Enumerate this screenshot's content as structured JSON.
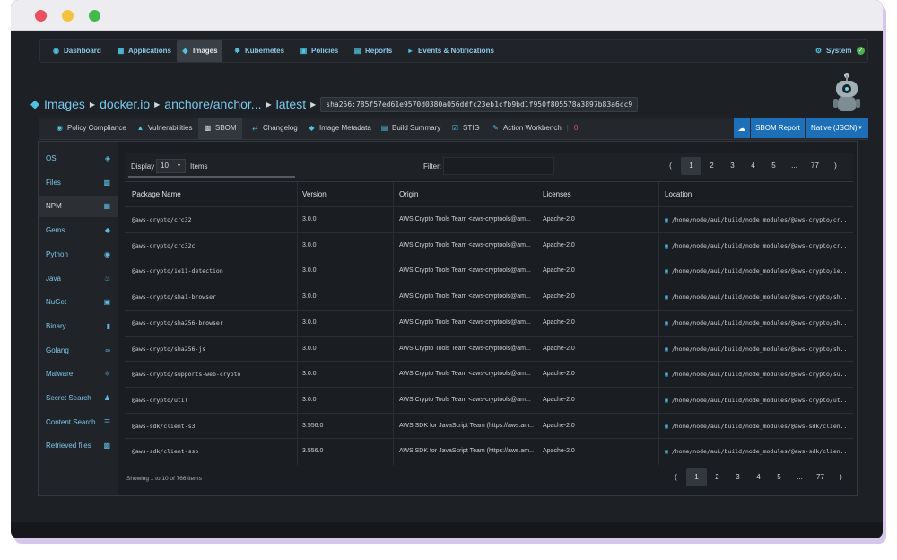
{
  "nav": {
    "items": [
      {
        "label": "Dashboard",
        "icon": "dashboard-icon"
      },
      {
        "label": "Applications",
        "icon": "grid-icon"
      },
      {
        "label": "Images",
        "icon": "tag-icon"
      },
      {
        "label": "Kubernetes",
        "icon": "kubernetes-icon"
      },
      {
        "label": "Policies",
        "icon": "briefcase-icon"
      },
      {
        "label": "Reports",
        "icon": "table-icon"
      },
      {
        "label": "Events & Notifications",
        "icon": "megaphone-icon"
      }
    ],
    "system_label": "System"
  },
  "breadcrumb": {
    "images": "Images",
    "registry": "docker.io",
    "repo": "anchore/anchor...",
    "tag": "latest",
    "digest": "sha256:785f57ed61e9570d0380a056ddfc23eb1cfb9bd1f950f805578a3897b83a6cc9"
  },
  "tabs": [
    {
      "label": "Policy Compliance",
      "icon": "policy-icon"
    },
    {
      "label": "Vulnerabilities",
      "icon": "flame-icon"
    },
    {
      "label": "SBOM",
      "icon": "file-icon"
    },
    {
      "label": "Changelog",
      "icon": "arrows-icon"
    },
    {
      "label": "Image Metadata",
      "icon": "tag-icon"
    },
    {
      "label": "Build Summary",
      "icon": "build-icon"
    },
    {
      "label": "STIG",
      "icon": "check-icon"
    },
    {
      "label": "Action Workbench",
      "icon": "edit-icon"
    }
  ],
  "action_count": "0",
  "sbom_report_label": "SBOM Report",
  "format_label": "Native (JSON)",
  "sidebar": [
    {
      "label": "OS",
      "icon": "drop-icon"
    },
    {
      "label": "Files",
      "icon": "file-icon"
    },
    {
      "label": "NPM",
      "icon": "npm-icon"
    },
    {
      "label": "Gems",
      "icon": "gem-icon"
    },
    {
      "label": "Python",
      "icon": "python-icon"
    },
    {
      "label": "Java",
      "icon": "java-icon"
    },
    {
      "label": "NuGet",
      "icon": "nuget-icon"
    },
    {
      "label": "Binary",
      "icon": "binary-icon"
    },
    {
      "label": "Golang",
      "icon": "golang-icon"
    },
    {
      "label": "Malware",
      "icon": "bug-icon"
    },
    {
      "label": "Secret Search",
      "icon": "user-secret-icon"
    },
    {
      "label": "Content Search",
      "icon": "list-icon"
    },
    {
      "label": "Retrieved files",
      "icon": "file-icon"
    }
  ],
  "table": {
    "display_label": "Display",
    "page_size": "10",
    "items_label": "Items",
    "filter_label": "Filter:",
    "columns": [
      "Package Name",
      "Version",
      "Origin",
      "Licenses",
      "Location"
    ],
    "rows": [
      [
        "@aws-crypto/crc32",
        "3.0.0",
        "AWS Crypto Tools Team <aws-cryptools@am...",
        "Apache-2.0",
        "/home/node/aui/build/node_modules/@aws-crypto/cr..."
      ],
      [
        "@aws-crypto/crc32c",
        "3.0.0",
        "AWS Crypto Tools Team <aws-cryptools@am...",
        "Apache-2.0",
        "/home/node/aui/build/node_modules/@aws-crypto/cr..."
      ],
      [
        "@aws-crypto/ie11-detection",
        "3.0.0",
        "AWS Crypto Tools Team <aws-cryptools@am...",
        "Apache-2.0",
        "/home/node/aui/build/node_modules/@aws-crypto/ie..."
      ],
      [
        "@aws-crypto/sha1-browser",
        "3.0.0",
        "AWS Crypto Tools Team <aws-cryptools@am...",
        "Apache-2.0",
        "/home/node/aui/build/node_modules/@aws-crypto/sh..."
      ],
      [
        "@aws-crypto/sha256-browser",
        "3.0.0",
        "AWS Crypto Tools Team <aws-cryptools@am...",
        "Apache-2.0",
        "/home/node/aui/build/node_modules/@aws-crypto/sh..."
      ],
      [
        "@aws-crypto/sha256-js",
        "3.0.0",
        "AWS Crypto Tools Team <aws-cryptools@am...",
        "Apache-2.0",
        "/home/node/aui/build/node_modules/@aws-crypto/sh..."
      ],
      [
        "@aws-crypto/supports-web-crypto",
        "3.0.0",
        "AWS Crypto Tools Team <aws-cryptools@am...",
        "Apache-2.0",
        "/home/node/aui/build/node_modules/@aws-crypto/su..."
      ],
      [
        "@aws-crypto/util",
        "3.0.0",
        "AWS Crypto Tools Team <aws-cryptools@am...",
        "Apache-2.0",
        "/home/node/aui/build/node_modules/@aws-crypto/ut..."
      ],
      [
        "@aws-sdk/client-s3",
        "3.556.0",
        "AWS SDK for JavaScript Team (https://aws.am...",
        "Apache-2.0",
        "/home/node/aui/build/node_modules/@aws-sdk/clien..."
      ],
      [
        "@aws-sdk/client-sso",
        "3.556.0",
        "AWS SDK for JavaScript Team (https://aws.am...",
        "Apache-2.0",
        "/home/node/aui/build/node_modules/@aws-sdk/clien..."
      ]
    ],
    "showing": "Showing 1 to 10 of 766 items",
    "pager": [
      "(",
      "1",
      "2",
      "3",
      "4",
      "5",
      "...",
      "77",
      ")"
    ]
  },
  "colors": {
    "accent": "#4fc3e0",
    "link": "#79c8ec",
    "danger": "#e25555",
    "ok": "#4caf50",
    "button": "#1d6fb8"
  }
}
